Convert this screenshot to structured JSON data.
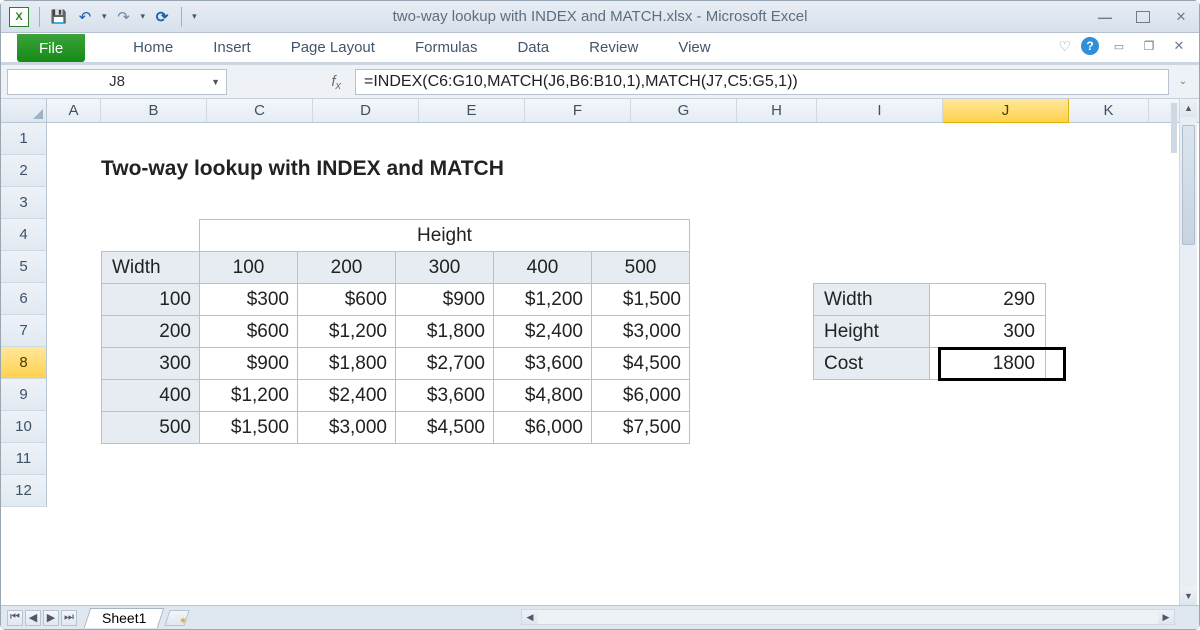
{
  "window": {
    "title": "two-way lookup with INDEX and MATCH.xlsx  -  Microsoft Excel"
  },
  "ribbon": {
    "file": "File",
    "tabs": [
      "Home",
      "Insert",
      "Page Layout",
      "Formulas",
      "Data",
      "Review",
      "View"
    ]
  },
  "namebox": "J8",
  "formula": "=INDEX(C6:G10,MATCH(J6,B6:B10,1),MATCH(J7,C5:G5,1))",
  "columns": [
    "A",
    "B",
    "C",
    "D",
    "E",
    "F",
    "G",
    "H",
    "I",
    "J",
    "K"
  ],
  "rows": [
    "1",
    "2",
    "3",
    "4",
    "5",
    "6",
    "7",
    "8",
    "9",
    "10",
    "11",
    "12"
  ],
  "selected": {
    "col": "J",
    "row": "8"
  },
  "sheet": {
    "title": "Two-way lookup with INDEX and MATCH",
    "height_label": "Height",
    "width_label": "Width",
    "heights": [
      "100",
      "200",
      "300",
      "400",
      "500"
    ],
    "widths": [
      "100",
      "200",
      "300",
      "400",
      "500"
    ],
    "costs": [
      [
        "$300",
        "$600",
        "$900",
        "$1,200",
        "$1,500"
      ],
      [
        "$600",
        "$1,200",
        "$1,800",
        "$2,400",
        "$3,000"
      ],
      [
        "$900",
        "$1,800",
        "$2,700",
        "$3,600",
        "$4,500"
      ],
      [
        "$1,200",
        "$2,400",
        "$3,600",
        "$4,800",
        "$6,000"
      ],
      [
        "$1,500",
        "$3,000",
        "$4,500",
        "$6,000",
        "$7,500"
      ]
    ],
    "lookup": {
      "width_label": "Width",
      "width_val": "290",
      "height_label": "Height",
      "height_val": "300",
      "cost_label": "Cost",
      "cost_val": "1800"
    }
  },
  "tabs": {
    "sheet1": "Sheet1"
  }
}
